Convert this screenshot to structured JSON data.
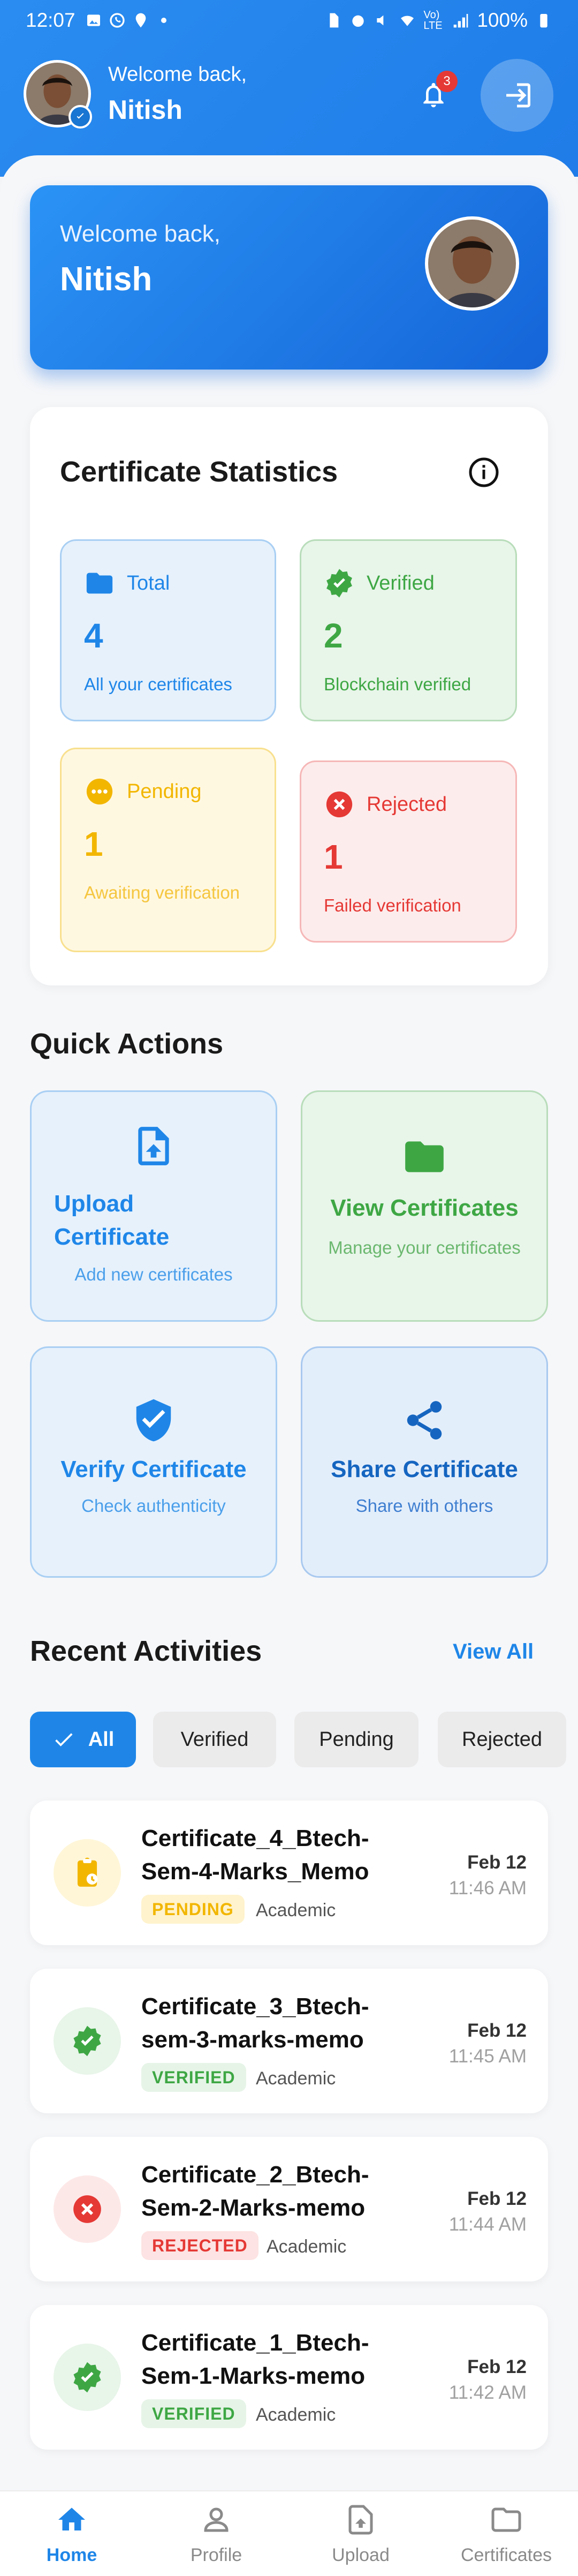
{
  "status_bar": {
    "time": "12:07",
    "battery": "100%",
    "network": "Vo) LTE"
  },
  "header": {
    "welcome": "Welcome back,",
    "name": "Nitish",
    "notification_count": "3"
  },
  "welcome_card": {
    "welcome": "Welcome back,",
    "name": "Nitish"
  },
  "stats": {
    "title": "Certificate Statistics",
    "total": {
      "label": "Total",
      "value": "4",
      "sub": "All your certificates"
    },
    "verified": {
      "label": "Verified",
      "value": "2",
      "sub": "Blockchain verified"
    },
    "pending": {
      "label": "Pending",
      "value": "1",
      "sub": "Awaiting verification"
    },
    "rejected": {
      "label": "Rejected",
      "value": "1",
      "sub": "Failed verification"
    }
  },
  "quick_actions": {
    "title": "Quick Actions",
    "upload": {
      "title": "Upload Certificate",
      "sub": "Add new certificates"
    },
    "view": {
      "title": "View Certificates",
      "sub": "Manage your certificates"
    },
    "verify": {
      "title": "Verify Certificate",
      "sub": "Check authenticity"
    },
    "share": {
      "title": "Share Certificate",
      "sub": "Share with others"
    }
  },
  "recent": {
    "title": "Recent Activities",
    "view_all": "View All",
    "filters": [
      "All",
      "Verified",
      "Pending",
      "Rejected"
    ],
    "items": [
      {
        "title": "Certificate_4_Btech-Sem-4-Marks_Memo",
        "status": "PENDING",
        "category": "Academic",
        "date": "Feb 12",
        "time": "11:46 AM"
      },
      {
        "title": "Certificate_3_Btech-sem-3-marks-memo",
        "status": "VERIFIED",
        "category": "Academic",
        "date": "Feb 12",
        "time": "11:45 AM"
      },
      {
        "title": "Certificate_2_Btech-Sem-2-Marks-memo",
        "status": "REJECTED",
        "category": "Academic",
        "date": "Feb 12",
        "time": "11:44 AM"
      },
      {
        "title": "Certificate_1_Btech-Sem-1-Marks-memo",
        "status": "VERIFIED",
        "category": "Academic",
        "date": "Feb 12",
        "time": "11:42 AM"
      }
    ]
  },
  "nav": {
    "home": "Home",
    "profile": "Profile",
    "upload": "Upload",
    "certificates": "Certificates"
  },
  "colors": {
    "primary": "#1f86e8",
    "verified": "#3ea744",
    "pending": "#f2b600",
    "rejected": "#e53935"
  }
}
